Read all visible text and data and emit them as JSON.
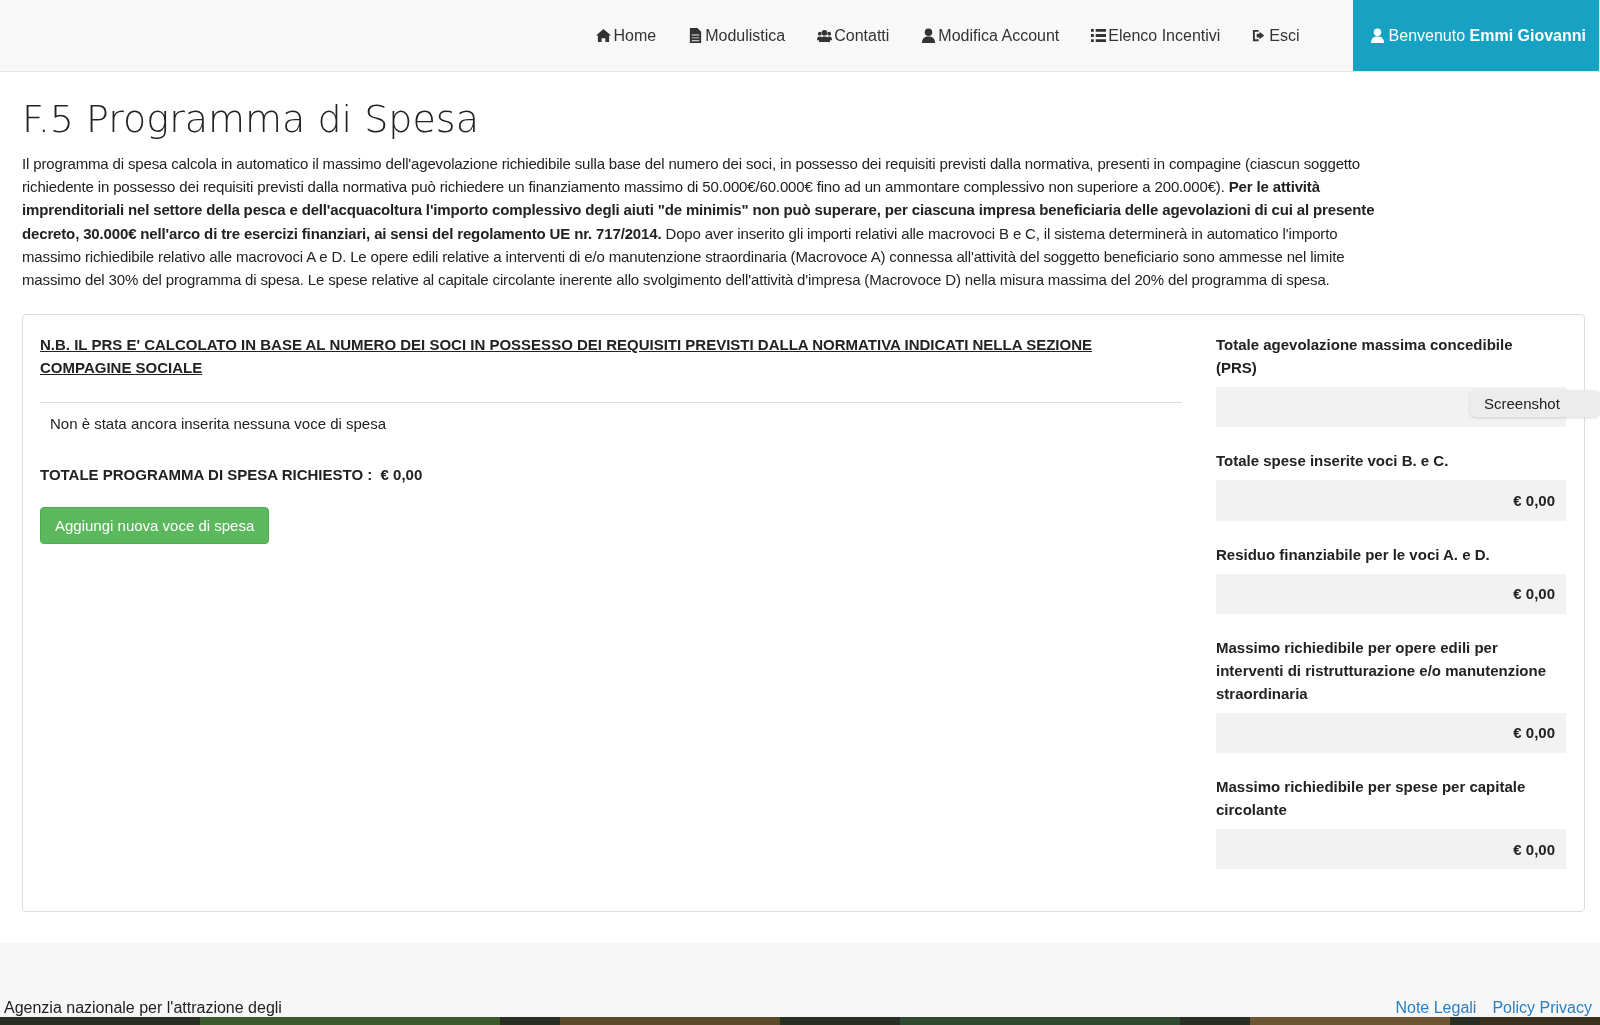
{
  "nav": {
    "items": [
      {
        "label": "Home"
      },
      {
        "label": "Modulistica"
      },
      {
        "label": "Contatti"
      },
      {
        "label": "Modifica Account"
      },
      {
        "label": "Elenco Incentivi"
      },
      {
        "label": "Esci"
      }
    ],
    "welcome": "Benvenuto **Emmi Giovanni**"
  },
  "page": {
    "title": "F.5 Programma di Spesa",
    "description": "Il programma di spesa calcola in automatico il massimo dell'agevolazione richiedibile sulla base del numero dei soci, in possesso dei requisiti previsti dalla normativa, presenti in compagine (ciascun soggetto richiedente in possesso dei requisiti previsti dalla normativa può richiedere un finanziamento massimo di 50.000€/60.000€ fino ad un ammontare complessivo non superiore a 200.000€). **Per le attività imprenditoriali nel settore della pesca e dell'acquacoltura l'importo complessivo degli aiuti \"de minimis\" non può superare, per ciascuna impresa beneficiaria delle agevolazioni di cui al presente decreto, 30.000€ nell'arco di tre esercizi finanziari, ai sensi del regolamento UE nr. 717/2014.** Dopo aver inserito gli importi relativi alle macrovoci B e C, il sistema determinerà in automatico l'importo massimo richiedibile relativo alle macrovoci A e D. Le opere edili relative a interventi di e/o manutenzione straordinaria (Macrovoce A) connessa all'attività del soggetto beneficiario sono ammesse nel limite massimo del 30% del programma di spesa. Le spese relative al capitale circolante inerente allo svolgimento dell'attività d'impresa (Macrovoce D) nella misura massima del 20% del programma di spesa."
  },
  "panel": {
    "note": "N.B. IL PRS E' CALCOLATO IN BASE AL NUMERO DEI SOCI IN POSSESSO DEI REQUISITI PREVISTI DALLA NORMATIVA INDICATI NELLA SEZIONE COMPAGINE SOCIALE",
    "empty_message": "Non è stata ancora inserita nessuna voce di spesa",
    "total_label": "TOTALE PROGRAMMA DI SPESA RICHIESTO :",
    "total_value": "€ 0,00",
    "add_button": "Aggiungi nuova voce di spesa",
    "summary": [
      {
        "label": "Totale agevolazione massima concedibile (PRS)"
      },
      {
        "label": "Totale spese inserite voci B. e C.",
        "value": "€ 0,00"
      },
      {
        "label": "Residuo finanziabile per le voci A. e D.",
        "value": "€ 0,00"
      },
      {
        "label": "Massimo richiedibile per opere edili per interventi di ristrutturazione e/o manutenzione straordinaria",
        "value": "€ 0,00"
      },
      {
        "label": "Massimo richiedibile per spese per capitale circolante",
        "value": "€ 0,00"
      }
    ]
  },
  "tooltip": "Screenshot",
  "footer": {
    "text": "Agenzia nazionale per l'attrazione degli",
    "links": [
      "Note Legali",
      "Policy Privacy"
    ]
  }
}
